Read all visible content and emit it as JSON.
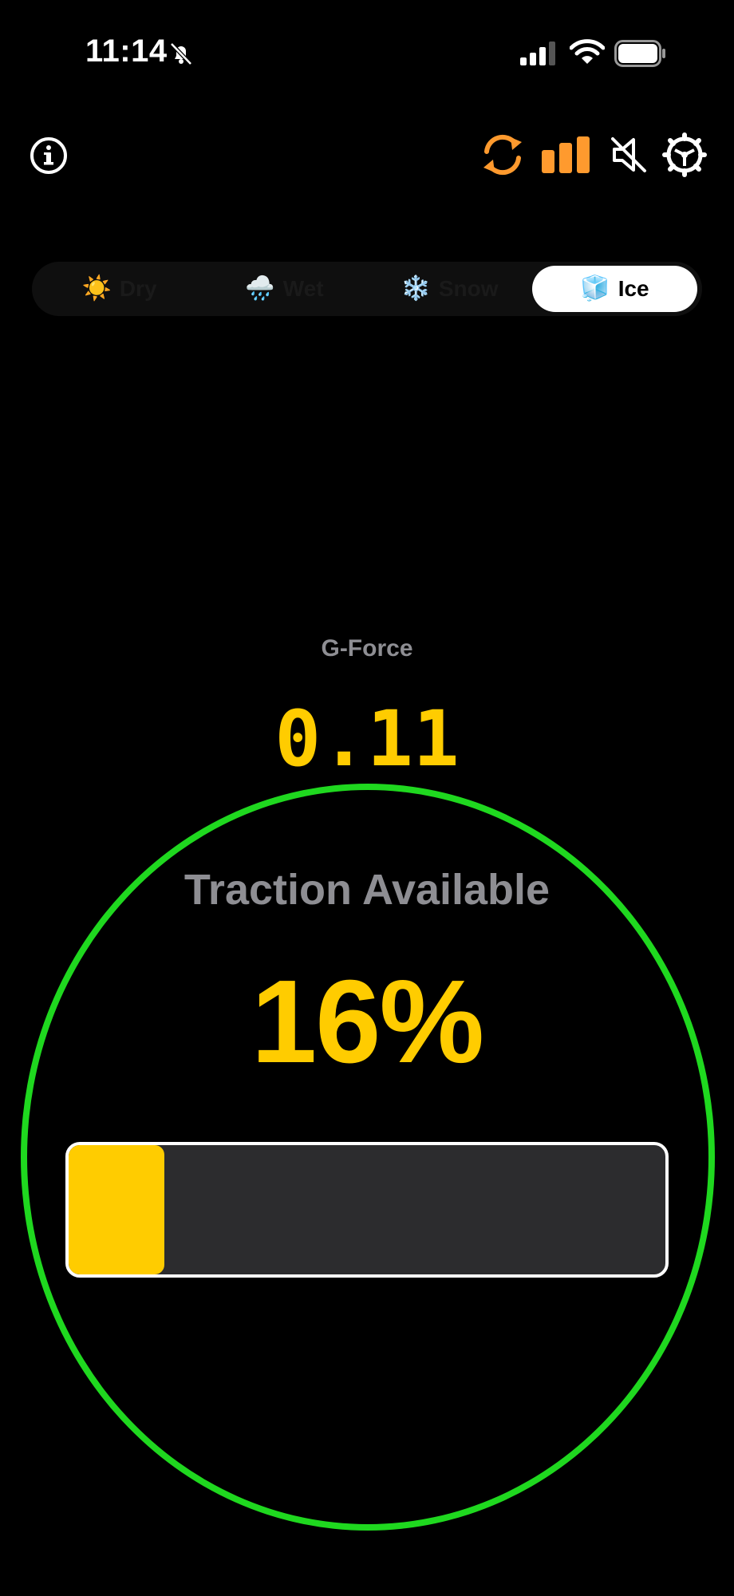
{
  "status_bar": {
    "time": "11:14",
    "silent_icon": "bell-slash-icon",
    "signal_icon": "cellular-signal-icon",
    "wifi_icon": "wifi-icon",
    "battery_icon": "battery-full-icon"
  },
  "toolbar": {
    "info_icon": "info-circle-icon",
    "sync_icon": "sync-icon",
    "stats_icon": "bar-chart-icon",
    "mute_icon": "speaker-muted-icon",
    "settings_icon": "gear-icon",
    "accent_color": "#ff9a2e"
  },
  "surface_selector": {
    "options": [
      {
        "emoji": "☀️",
        "label": "Dry"
      },
      {
        "emoji": "🌧️",
        "label": "Wet"
      },
      {
        "emoji": "❄️",
        "label": "Snow"
      },
      {
        "emoji": "🧊",
        "label": "Ice"
      }
    ],
    "selected": "Ice"
  },
  "gforce": {
    "label": "G-Force",
    "value": "0.11"
  },
  "traction": {
    "label": "Traction Available",
    "value": "16%",
    "fraction": 0.16,
    "ring_color": "#1fd81f",
    "value_color": "#ffcc00"
  }
}
